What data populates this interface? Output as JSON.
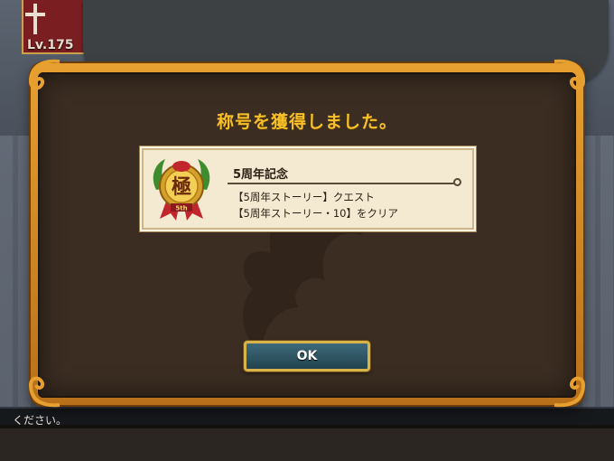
{
  "player": {
    "level_text": "Lv.175"
  },
  "dialog": {
    "title": "称号を獲得しました。",
    "ok_label": "OK"
  },
  "title_card": {
    "medal_kanji": "極",
    "medal_caption": "5th",
    "name": "5周年記念",
    "description_line1": "【5周年ストーリー】クエスト",
    "description_line2": "【5周年ストーリー・10】をクリア"
  },
  "background": {
    "bottom_text": "ください。"
  },
  "colors": {
    "frame_gold": "#e7a02f",
    "panel_brown": "#3b2d22",
    "title_yellow": "#f7c02a",
    "card_cream": "#f4ead1",
    "button_teal": "#2f5a6a"
  }
}
